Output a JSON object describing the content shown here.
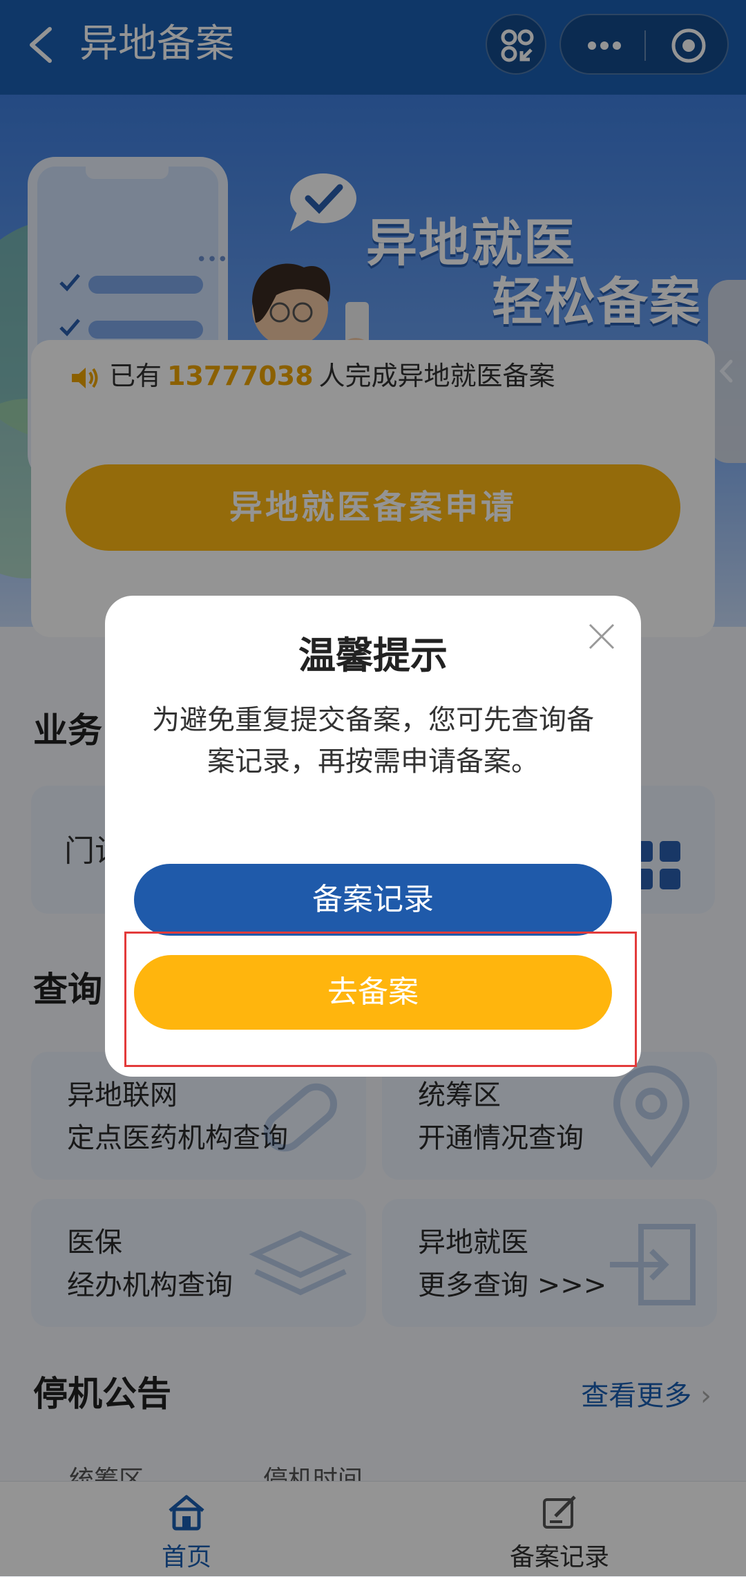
{
  "topbar": {
    "title": "异地备案",
    "icons": {
      "back": "back-chevron-icon",
      "scan": "scan-icon",
      "more": "more-dots-icon",
      "close": "close-target-icon"
    }
  },
  "banner": {
    "slogan_line1": "异地就医",
    "slogan_line2": "轻松备案"
  },
  "info_card": {
    "prefix": "已有",
    "count": "13777038",
    "suffix": "人完成异地就医备案",
    "apply_button": "异地就医备案申请"
  },
  "sections": {
    "business_title": "业务",
    "service_label": "门诊",
    "query_title": "查询"
  },
  "query_cards": [
    {
      "line1": "异地联网",
      "line2": "定点医药机构查询"
    },
    {
      "line1": "统筹区",
      "line2": "开通情况查询"
    },
    {
      "line1": "医保",
      "line2": "经办机构查询"
    },
    {
      "line1": "异地就医",
      "line2": "更多查询 >>>"
    }
  ],
  "notice": {
    "title": "停机公告",
    "more": "查看更多",
    "col1": "统筹区",
    "col2": "停机时间"
  },
  "tabbar": [
    {
      "label": "首页",
      "icon": "home-icon",
      "active": true
    },
    {
      "label": "备案记录",
      "icon": "edit-record-icon",
      "active": false
    }
  ],
  "modal": {
    "title": "温馨提示",
    "message_line1": "为避免重复提交备案，您可先查询备",
    "message_line2": "案记录，再按需申请备案。",
    "record_button": "备案记录",
    "go_button": "去备案"
  },
  "colors": {
    "brand_blue": "#1a5fb4",
    "accent_yellow": "#ffb50d",
    "highlight_red": "#e33b3b"
  }
}
